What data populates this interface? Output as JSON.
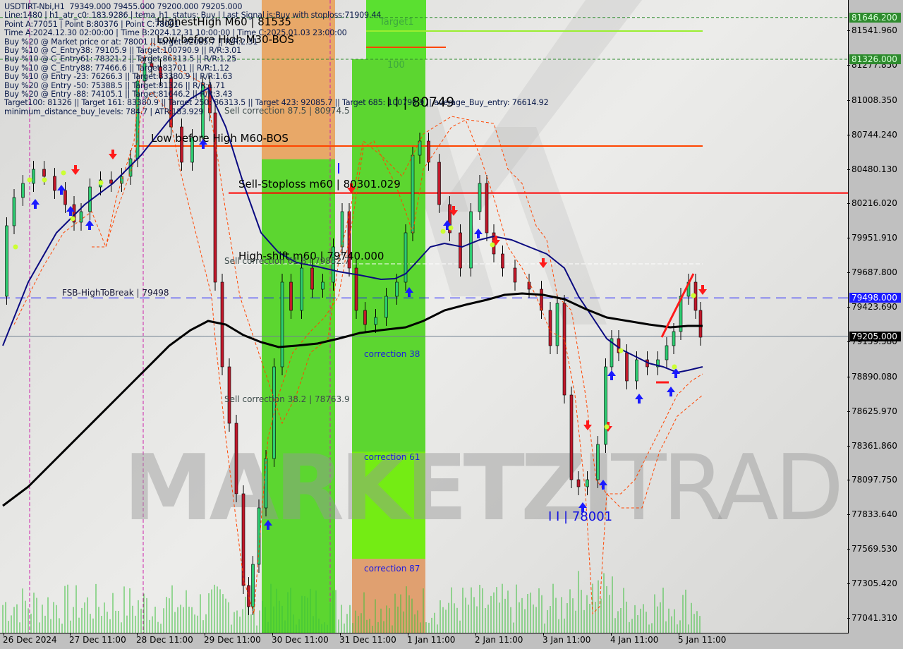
{
  "chart_data": {
    "type": "candlestick",
    "symbol": "USDTIRT-Nbi",
    "timeframe": "H1",
    "ohlc_header": {
      "open": "79349.000",
      "high": "79455.000",
      "low": "79200.000",
      "close": "79205.000"
    },
    "title": "USDTIRT-Nbi,H1  79349.000 79455.000 79200.000 79205.000",
    "ylim": [
      76900,
      81720
    ],
    "y_ticks": [
      "81541.960",
      "81277.850",
      "81008.350",
      "80744.240",
      "80480.130",
      "80216.020",
      "79951.910",
      "79687.800",
      "79423.690",
      "79159.580",
      "78890.080",
      "78625.970",
      "78361.860",
      "78097.750",
      "77833.640",
      "77569.530",
      "77305.420",
      "77041.310"
    ],
    "y_badges": [
      {
        "value": "81646.200",
        "bg": "#2e8b2e",
        "fg": "#d8ffd8"
      },
      {
        "value": "81326.000",
        "bg": "#2e8b2e",
        "fg": "#d8ffd8"
      },
      {
        "value": "79498.000",
        "bg": "#1a1aff",
        "fg": "#ffffff"
      },
      {
        "value": "79205.000",
        "bg": "#000000",
        "fg": "#ffffff"
      }
    ],
    "x_ticks": [
      "26 Dec 2024",
      "27 Dec 11:00",
      "28 Dec 11:00",
      "29 Dec 11:00",
      "30 Dec 11:00",
      "31 Dec 11:00",
      "1 Jan 11:00",
      "2 Jan 11:00",
      "3 Jan 11:00",
      "4 Jan 11:00",
      "5 Jan 11:00"
    ],
    "info_lines": [
      "USDTIRT-Nbi,H1  79349.000 79455.000 79200.000 79205.000",
      "Line:1480 | h1_atr_c0: 183.9286 | tema_h1_status: Buy | Last Signal is:Buy with stoploss:71909.44",
      "Point A:77051 | Point B:80376 | Point C:78001",
      "Time A:2024.12.30 02:00:00 | Time B:2024.12.31 10:00:00 | Time C:2025.01.03 23:00:00",
      "Buy %20 @ Market price or at: 78001 || Target:92085.7 || R/R:2.31",
      "Buy %10 @ C_Entry38: 79105.9 || Target:100790.9 || R/R:3.01",
      "Buy %10 @ C_Entry61: 78321.2 || Target:86313.5 || R/R:1.25",
      "Buy %10 @ C_Entry88: 77466.6 || Target:83701 || R/R:1.12",
      "Buy %10 @ Entry -23: 76266.3 || Target:83380.9 || R/R:1.63",
      "Buy %20 @ Entry -50: 75388.5 || Target:81326 || R/R:1.71",
      "Buy %20 @ Entry -88: 74105.1 || Target:81646.2 || R/R:3.43",
      "Target100: 81326 || Target 161: 83380.9 || Target 250: 86313.5 || Target 423: 92085.7 || Target 685: 100790.9 || average_Buy_entry: 76614.92",
      "minimum_distance_buy_levels: 784.7 | ATR:183.929"
    ],
    "levels": [
      {
        "name": "Target1",
        "price": 81646.2,
        "style": "dashed",
        "color": "#2e8b2e"
      },
      {
        "name": "Target100",
        "price": 81326,
        "style": "dashed",
        "color": "#2e8b2e"
      },
      {
        "name": "HighestHigh M60",
        "price": 81535,
        "style": "solid",
        "color": "#9acd32"
      },
      {
        "name": "Low before High M30-BOS",
        "price": 81380,
        "style": "solid",
        "color": "#ff4500"
      },
      {
        "name": "Low before High M60-BOS",
        "price": 80640,
        "style": "solid",
        "color": "#ff4500"
      },
      {
        "name": "Sell-Stoploss m60",
        "price": 80301.029,
        "style": "solid",
        "color": "#ff0000"
      },
      {
        "name": "FSB-HighToBreak",
        "price": 79498,
        "style": "dashed",
        "color": "#1a1aff"
      },
      {
        "name": "Current price",
        "price": 79205,
        "style": "solid",
        "color": "#708090"
      }
    ],
    "labels": {
      "highest_high": "HighestHigh   M60 | 81535",
      "low_before_high_m30": "Low before High   M30-BOS",
      "low_before_high_m60": "Low before High   M60-BOS",
      "sell_stoploss": "Sell-Stoploss m60 | 80301.029",
      "high_shift": "High-shift m60 | 79740.000",
      "sell_corr_875": "Sell correction 87.5 | 80974.5",
      "sell_corr_618": "Sell correction 61.8 | 79852.7",
      "sell_corr_382": "Sell correction 38.2 | 78763.9",
      "fsb": "FSB-HighToBreak | 79498",
      "point_b": "I I | 80749",
      "point_c": "I I | 78001",
      "target1": "Target1",
      "target100": "100",
      "corr38": "correction 38",
      "corr61": "correction 61",
      "corr87": "correction 87",
      "watermark_bold": "MARKETZI",
      "watermark_thin": "TRADE"
    },
    "zones": [
      {
        "name": "sell-zone-orange",
        "from_price": 81720,
        "to_price": 76900,
        "color": "#e8a060"
      },
      {
        "name": "buy-zone-green-1",
        "from_price": 80560,
        "to_price": 76900,
        "color": "#5cd630"
      },
      {
        "name": "buy-zone-green-2",
        "from_price": 81326,
        "to_price": 77500,
        "color": "#5cd630"
      },
      {
        "name": "target-zone-green",
        "from_price": 81720,
        "to_price": 81326,
        "color": "#5cd630"
      }
    ]
  }
}
